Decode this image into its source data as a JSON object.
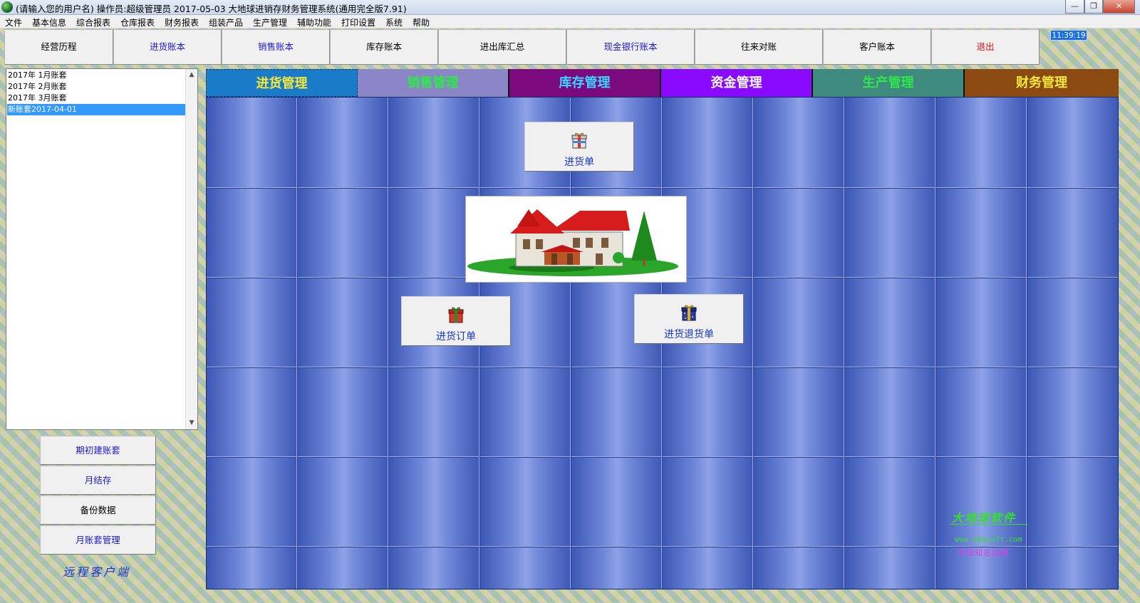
{
  "window": {
    "title": "(请输入您的用户名) 操作员:超级管理员   2017-05-03  大地球进销存财务管理系统(通用完全版7.91)",
    "minimize": "—",
    "maximize": "❐",
    "close": "✕"
  },
  "menu": [
    "文件",
    "基本信息",
    "综合报表",
    "仓库报表",
    "财务报表",
    "组装产品",
    "生产管理",
    "辅助功能",
    "打印设置",
    "系统",
    "帮助"
  ],
  "toolbar": [
    {
      "label": "经营历程",
      "color": "#000000"
    },
    {
      "label": "进货账本",
      "color": "#1a1ad6"
    },
    {
      "label": "销售账本",
      "color": "#1a1ad6"
    },
    {
      "label": "库存账本",
      "color": "#000000"
    },
    {
      "label": "进出库汇总",
      "color": "#000000"
    },
    {
      "label": "现金银行账本",
      "color": "#1a1ad6"
    },
    {
      "label": "往来对账",
      "color": "#000000"
    },
    {
      "label": "客户账本",
      "color": "#000000"
    },
    {
      "label": "退出",
      "color": "#e01414"
    }
  ],
  "clock": "11:39:19",
  "accounts": {
    "items": [
      "2017年 1月账套",
      "2017年 2月账套",
      "2017年 3月账套",
      "新账套2017-04-01"
    ],
    "selected_index": 3
  },
  "left_buttons": [
    {
      "label": "期初建账套",
      "color": "#1a1ad6"
    },
    {
      "label": "月结存",
      "color": "#1a1ad6"
    },
    {
      "label": "备份数据",
      "color": "#000000"
    },
    {
      "label": "月账套管理",
      "color": "#1a1ad6"
    }
  ],
  "remote_client": "远程客户端",
  "tabs": [
    {
      "label": "进货管理",
      "bg": "#1a7cc9",
      "color": "#f4e83a",
      "active": true
    },
    {
      "label": "销售管理",
      "bg": "#8a86c8",
      "color": "#2ee84a",
      "active": false
    },
    {
      "label": "库存管理",
      "bg": "#7a0a7e",
      "color": "#3ad6ff",
      "active": false
    },
    {
      "label": "资金管理",
      "bg": "#8a0aff",
      "color": "#ffffff",
      "active": false
    },
    {
      "label": "生产管理",
      "bg": "#3f8a7e",
      "color": "#2ee84a",
      "active": false
    },
    {
      "label": "财务管理",
      "bg": "#8a4a12",
      "color": "#f4e83a",
      "active": false
    }
  ],
  "actions": {
    "purchase_order": "进货单",
    "purchase_request": "进货订单",
    "purchase_return": "进货退货单"
  },
  "brand": {
    "name": "大地球软件",
    "url": "www.ddqsoft.com",
    "sub": "中国知名品牌"
  },
  "icons": {
    "app": "globe-icon",
    "gift": "gift-box-icon",
    "house": "house-illustration"
  }
}
